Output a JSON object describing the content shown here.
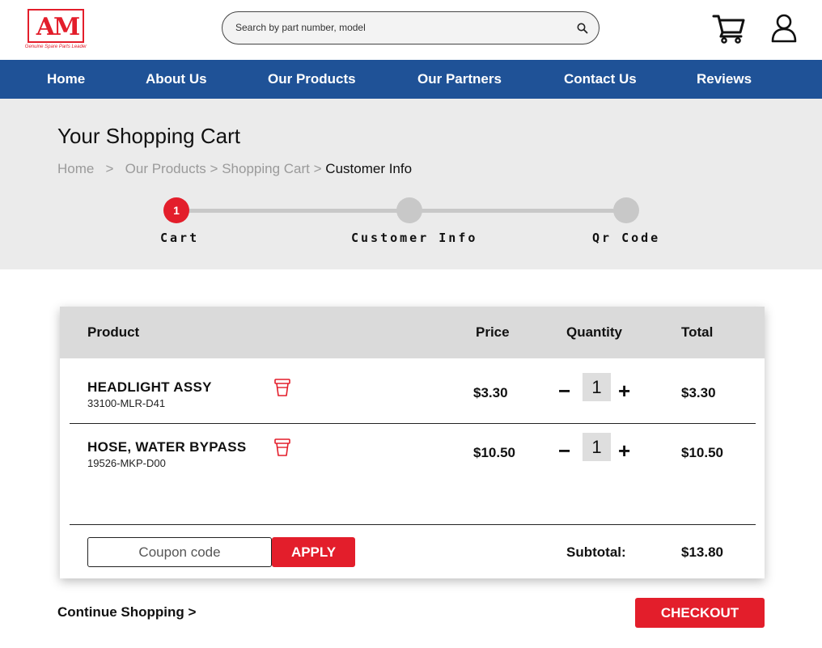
{
  "header": {
    "logo_text": "AM",
    "logo_tagline": "Genuine Spare Parts Leader",
    "search_placeholder": "Search by part number, model",
    "icons": {
      "search": "search-icon",
      "cart": "cart-icon",
      "user": "user-icon"
    }
  },
  "nav": {
    "items": [
      {
        "label": "Home"
      },
      {
        "label": "About Us"
      },
      {
        "label": "Our Products"
      },
      {
        "label": "Our Partners"
      },
      {
        "label": "Contact Us"
      },
      {
        "label": "Reviews"
      }
    ]
  },
  "page": {
    "title": "Your Shopping Cart",
    "breadcrumb": {
      "home": "Home",
      "sep1": ">",
      "products": "Our Products",
      "sep2": ">",
      "cart": "Shopping Cart",
      "sep3": ">",
      "current": "Customer Info"
    }
  },
  "stepper": {
    "steps": [
      {
        "number": "1",
        "label": "Cart",
        "active": true
      },
      {
        "number": "",
        "label": "Customer Info",
        "active": false
      },
      {
        "number": "",
        "label": "Qr Code",
        "active": false
      }
    ]
  },
  "cart": {
    "headers": {
      "product": "Product",
      "price": "Price",
      "quantity": "Quantity",
      "total": "Total"
    },
    "items": [
      {
        "name": "HEADLIGHT ASSY",
        "code": "33100-MLR-D41",
        "price": "$3.30",
        "qty": "1",
        "total": "$3.30"
      },
      {
        "name": "HOSE, WATER BYPASS",
        "code": "19526-MKP-D00",
        "price": "$10.50",
        "qty": "1",
        "total": "$10.50"
      }
    ],
    "qty_minus": "−",
    "qty_plus": "+",
    "coupon_placeholder": "Coupon code",
    "apply_label": "APPLY",
    "subtotal_label": "Subtotal:",
    "subtotal_value": "$13.80"
  },
  "footer": {
    "continue_label": "Continue Shopping >",
    "checkout_label": "CHECKOUT"
  },
  "colors": {
    "accent": "#e31e2b",
    "nav_bg": "#1f5297",
    "hero_bg": "#ebebeb",
    "table_head_bg": "#dadada"
  }
}
